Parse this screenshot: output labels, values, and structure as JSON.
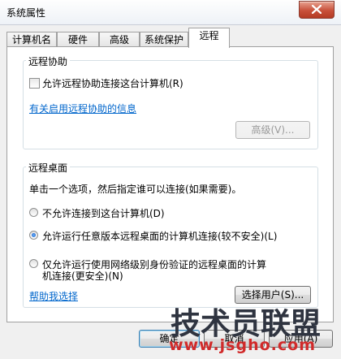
{
  "window": {
    "title": "系统属性"
  },
  "tabs": [
    {
      "label": "计算机名"
    },
    {
      "label": "硬件"
    },
    {
      "label": "高级"
    },
    {
      "label": "系统保护"
    },
    {
      "label": "远程"
    }
  ],
  "remote_assistance": {
    "group_label": "远程协助",
    "checkbox_label": "允许远程协助连接这台计算机(R)",
    "checked": false,
    "info_link": "有关启用远程协助的信息",
    "advanced_button": "高级(V)..."
  },
  "remote_desktop": {
    "group_label": "远程桌面",
    "instruction": "单击一个选项，然后指定谁可以连接(如果需要)。",
    "options": [
      {
        "label": "不允许连接到这台计算机(D)",
        "selected": false
      },
      {
        "label": "允许运行任意版本远程桌面的计算机连接(较不安全)(L)",
        "selected": true
      },
      {
        "label_line1": "仅允许运行使用网络级别身份验证的远程桌面的计算",
        "label_line2": "机连接(更安全)(N)",
        "selected": false
      }
    ],
    "help_link": "帮助我选择",
    "select_users_button": "选择用户(S)..."
  },
  "footer": {
    "ok_button": "确定",
    "cancel_button": "取消",
    "apply_button": "应用(A)"
  },
  "watermark": {
    "text": "技术员联盟",
    "url": "www.jsgho.com"
  }
}
